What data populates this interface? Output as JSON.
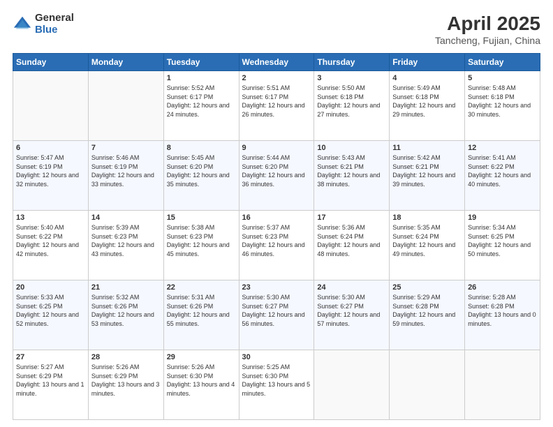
{
  "logo": {
    "general": "General",
    "blue": "Blue"
  },
  "title": "April 2025",
  "subtitle": "Tancheng, Fujian, China",
  "days_header": [
    "Sunday",
    "Monday",
    "Tuesday",
    "Wednesday",
    "Thursday",
    "Friday",
    "Saturday"
  ],
  "weeks": [
    [
      {
        "day": "",
        "sunrise": "",
        "sunset": "",
        "daylight": ""
      },
      {
        "day": "",
        "sunrise": "",
        "sunset": "",
        "daylight": ""
      },
      {
        "day": "1",
        "sunrise": "Sunrise: 5:52 AM",
        "sunset": "Sunset: 6:17 PM",
        "daylight": "Daylight: 12 hours and 24 minutes."
      },
      {
        "day": "2",
        "sunrise": "Sunrise: 5:51 AM",
        "sunset": "Sunset: 6:17 PM",
        "daylight": "Daylight: 12 hours and 26 minutes."
      },
      {
        "day": "3",
        "sunrise": "Sunrise: 5:50 AM",
        "sunset": "Sunset: 6:18 PM",
        "daylight": "Daylight: 12 hours and 27 minutes."
      },
      {
        "day": "4",
        "sunrise": "Sunrise: 5:49 AM",
        "sunset": "Sunset: 6:18 PM",
        "daylight": "Daylight: 12 hours and 29 minutes."
      },
      {
        "day": "5",
        "sunrise": "Sunrise: 5:48 AM",
        "sunset": "Sunset: 6:18 PM",
        "daylight": "Daylight: 12 hours and 30 minutes."
      }
    ],
    [
      {
        "day": "6",
        "sunrise": "Sunrise: 5:47 AM",
        "sunset": "Sunset: 6:19 PM",
        "daylight": "Daylight: 12 hours and 32 minutes."
      },
      {
        "day": "7",
        "sunrise": "Sunrise: 5:46 AM",
        "sunset": "Sunset: 6:19 PM",
        "daylight": "Daylight: 12 hours and 33 minutes."
      },
      {
        "day": "8",
        "sunrise": "Sunrise: 5:45 AM",
        "sunset": "Sunset: 6:20 PM",
        "daylight": "Daylight: 12 hours and 35 minutes."
      },
      {
        "day": "9",
        "sunrise": "Sunrise: 5:44 AM",
        "sunset": "Sunset: 6:20 PM",
        "daylight": "Daylight: 12 hours and 36 minutes."
      },
      {
        "day": "10",
        "sunrise": "Sunrise: 5:43 AM",
        "sunset": "Sunset: 6:21 PM",
        "daylight": "Daylight: 12 hours and 38 minutes."
      },
      {
        "day": "11",
        "sunrise": "Sunrise: 5:42 AM",
        "sunset": "Sunset: 6:21 PM",
        "daylight": "Daylight: 12 hours and 39 minutes."
      },
      {
        "day": "12",
        "sunrise": "Sunrise: 5:41 AM",
        "sunset": "Sunset: 6:22 PM",
        "daylight": "Daylight: 12 hours and 40 minutes."
      }
    ],
    [
      {
        "day": "13",
        "sunrise": "Sunrise: 5:40 AM",
        "sunset": "Sunset: 6:22 PM",
        "daylight": "Daylight: 12 hours and 42 minutes."
      },
      {
        "day": "14",
        "sunrise": "Sunrise: 5:39 AM",
        "sunset": "Sunset: 6:23 PM",
        "daylight": "Daylight: 12 hours and 43 minutes."
      },
      {
        "day": "15",
        "sunrise": "Sunrise: 5:38 AM",
        "sunset": "Sunset: 6:23 PM",
        "daylight": "Daylight: 12 hours and 45 minutes."
      },
      {
        "day": "16",
        "sunrise": "Sunrise: 5:37 AM",
        "sunset": "Sunset: 6:23 PM",
        "daylight": "Daylight: 12 hours and 46 minutes."
      },
      {
        "day": "17",
        "sunrise": "Sunrise: 5:36 AM",
        "sunset": "Sunset: 6:24 PM",
        "daylight": "Daylight: 12 hours and 48 minutes."
      },
      {
        "day": "18",
        "sunrise": "Sunrise: 5:35 AM",
        "sunset": "Sunset: 6:24 PM",
        "daylight": "Daylight: 12 hours and 49 minutes."
      },
      {
        "day": "19",
        "sunrise": "Sunrise: 5:34 AM",
        "sunset": "Sunset: 6:25 PM",
        "daylight": "Daylight: 12 hours and 50 minutes."
      }
    ],
    [
      {
        "day": "20",
        "sunrise": "Sunrise: 5:33 AM",
        "sunset": "Sunset: 6:25 PM",
        "daylight": "Daylight: 12 hours and 52 minutes."
      },
      {
        "day": "21",
        "sunrise": "Sunrise: 5:32 AM",
        "sunset": "Sunset: 6:26 PM",
        "daylight": "Daylight: 12 hours and 53 minutes."
      },
      {
        "day": "22",
        "sunrise": "Sunrise: 5:31 AM",
        "sunset": "Sunset: 6:26 PM",
        "daylight": "Daylight: 12 hours and 55 minutes."
      },
      {
        "day": "23",
        "sunrise": "Sunrise: 5:30 AM",
        "sunset": "Sunset: 6:27 PM",
        "daylight": "Daylight: 12 hours and 56 minutes."
      },
      {
        "day": "24",
        "sunrise": "Sunrise: 5:30 AM",
        "sunset": "Sunset: 6:27 PM",
        "daylight": "Daylight: 12 hours and 57 minutes."
      },
      {
        "day": "25",
        "sunrise": "Sunrise: 5:29 AM",
        "sunset": "Sunset: 6:28 PM",
        "daylight": "Daylight: 12 hours and 59 minutes."
      },
      {
        "day": "26",
        "sunrise": "Sunrise: 5:28 AM",
        "sunset": "Sunset: 6:28 PM",
        "daylight": "Daylight: 13 hours and 0 minutes."
      }
    ],
    [
      {
        "day": "27",
        "sunrise": "Sunrise: 5:27 AM",
        "sunset": "Sunset: 6:29 PM",
        "daylight": "Daylight: 13 hours and 1 minute."
      },
      {
        "day": "28",
        "sunrise": "Sunrise: 5:26 AM",
        "sunset": "Sunset: 6:29 PM",
        "daylight": "Daylight: 13 hours and 3 minutes."
      },
      {
        "day": "29",
        "sunrise": "Sunrise: 5:26 AM",
        "sunset": "Sunset: 6:30 PM",
        "daylight": "Daylight: 13 hours and 4 minutes."
      },
      {
        "day": "30",
        "sunrise": "Sunrise: 5:25 AM",
        "sunset": "Sunset: 6:30 PM",
        "daylight": "Daylight: 13 hours and 5 minutes."
      },
      {
        "day": "",
        "sunrise": "",
        "sunset": "",
        "daylight": ""
      },
      {
        "day": "",
        "sunrise": "",
        "sunset": "",
        "daylight": ""
      },
      {
        "day": "",
        "sunrise": "",
        "sunset": "",
        "daylight": ""
      }
    ]
  ]
}
